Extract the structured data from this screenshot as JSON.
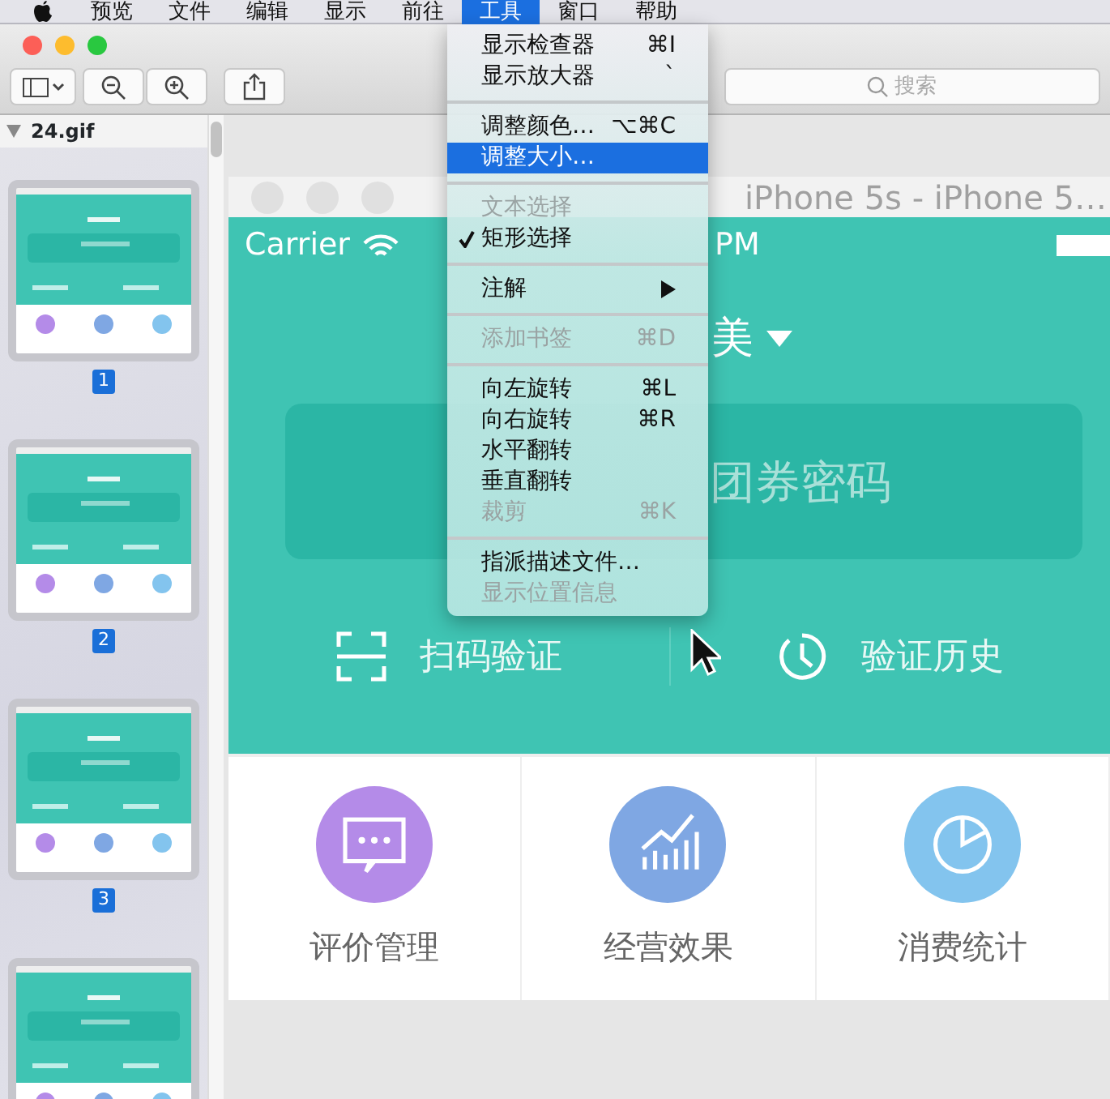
{
  "menubar": {
    "items": [
      {
        "label": "预览",
        "selected": false
      },
      {
        "label": "文件",
        "selected": false
      },
      {
        "label": "编辑",
        "selected": false
      },
      {
        "label": "显示",
        "selected": false
      },
      {
        "label": "前往",
        "selected": false
      },
      {
        "label": "工具",
        "selected": true
      },
      {
        "label": "窗口",
        "selected": false
      },
      {
        "label": "帮助",
        "selected": false
      }
    ]
  },
  "menu": {
    "items": [
      {
        "kind": "item",
        "label": "显示检查器",
        "shortcut": "⌘I",
        "disabled": false,
        "checked": false,
        "selected": false
      },
      {
        "kind": "item",
        "label": "显示放大器",
        "shortcut": "`",
        "disabled": false,
        "checked": false,
        "selected": false
      },
      {
        "kind": "separator"
      },
      {
        "kind": "item",
        "label": "调整颜色…",
        "shortcut": "⌥⌘C",
        "disabled": false,
        "checked": false,
        "selected": false
      },
      {
        "kind": "item",
        "label": "调整大小…",
        "disabled": false,
        "checked": false,
        "selected": true
      },
      {
        "kind": "separator"
      },
      {
        "kind": "item",
        "label": "文本选择",
        "disabled": true,
        "checked": false,
        "selected": false
      },
      {
        "kind": "item",
        "label": "矩形选择",
        "disabled": false,
        "checked": true,
        "selected": false
      },
      {
        "kind": "separator"
      },
      {
        "kind": "submenu",
        "label": "注解",
        "disabled": false,
        "checked": false,
        "selected": false
      },
      {
        "kind": "separator"
      },
      {
        "kind": "item",
        "label": "添加书签",
        "shortcut": "⌘D",
        "disabled": true,
        "checked": false,
        "selected": false
      },
      {
        "kind": "separator"
      },
      {
        "kind": "item",
        "label": "向左旋转",
        "shortcut": "⌘L",
        "disabled": false,
        "checked": false,
        "selected": false
      },
      {
        "kind": "item",
        "label": "向右旋转",
        "shortcut": "⌘R",
        "disabled": false,
        "checked": false,
        "selected": false
      },
      {
        "kind": "item",
        "label": "水平翻转",
        "disabled": false,
        "checked": false,
        "selected": false
      },
      {
        "kind": "item",
        "label": "垂直翻转",
        "disabled": false,
        "checked": false,
        "selected": false
      },
      {
        "kind": "item",
        "label": "裁剪",
        "shortcut": "⌘K",
        "disabled": true,
        "checked": false,
        "selected": false
      },
      {
        "kind": "separator"
      },
      {
        "kind": "item",
        "label": "指派描述文件…",
        "disabled": false,
        "checked": false,
        "selected": false
      },
      {
        "kind": "item",
        "label": "显示位置信息",
        "disabled": true,
        "checked": false,
        "selected": false
      }
    ]
  },
  "toolbar": {
    "search": {
      "placeholder": "搜索"
    }
  },
  "sidebar": {
    "file": "24.gif",
    "expanded": true,
    "pages": [
      {
        "label": "1"
      },
      {
        "label": "2"
      },
      {
        "label": "3"
      }
    ],
    "more_below": true
  },
  "simulator": {
    "title": "iPhone 5s - iPhone 5…",
    "status": {
      "carrier": "Carrier",
      "time": "PM"
    },
    "store": "美",
    "input": {
      "placeholder": "团券密码"
    },
    "actions": [
      {
        "kind": "scan",
        "label": "扫码验证"
      },
      {
        "kind": "history",
        "label": "验证历史"
      }
    ],
    "features": [
      {
        "kind": "comment",
        "label": "评价管理",
        "color": "#b48be8"
      },
      {
        "kind": "chart",
        "label": "经营效果",
        "color": "#7fa7e3"
      },
      {
        "kind": "pie",
        "label": "消费统计",
        "color": "#83c4ee"
      }
    ]
  }
}
